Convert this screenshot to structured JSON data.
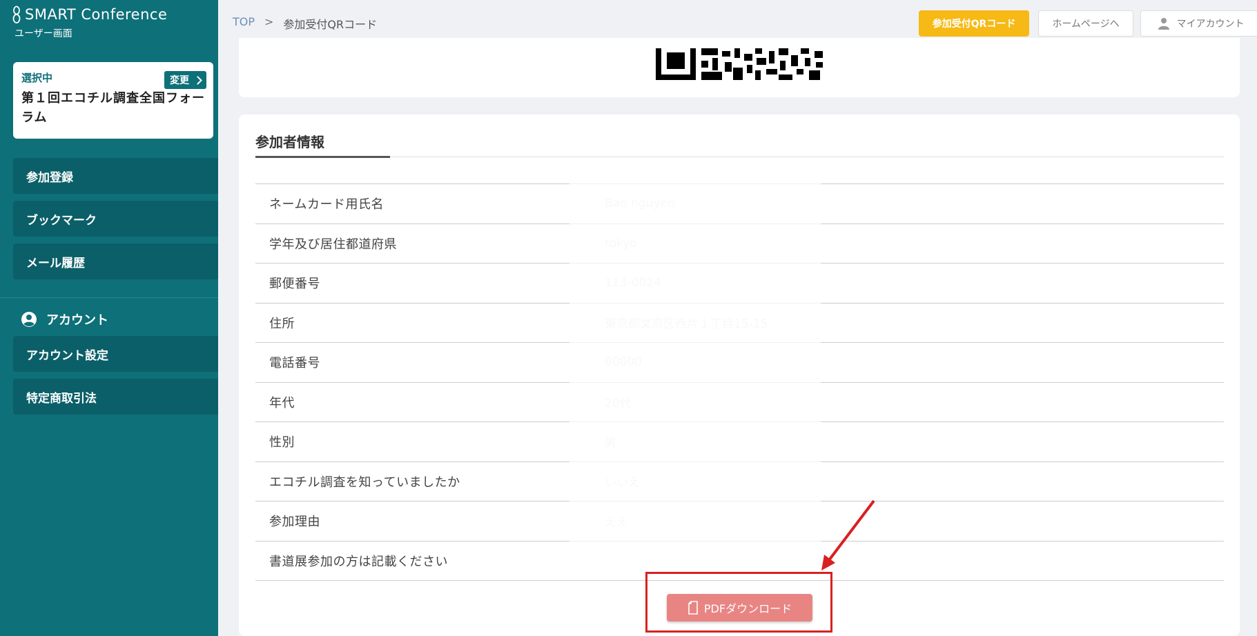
{
  "brand": {
    "title": "SMART Conference",
    "subtitle": "ユーザー画面"
  },
  "selected": {
    "label": "選択中",
    "change": "変更",
    "event_name": "第１回エコチル調査全国フォーラム"
  },
  "nav": {
    "items": [
      "参加登録",
      "ブックマーク",
      "メール履歴"
    ]
  },
  "account": {
    "heading": "アカウント",
    "items": [
      "アカウント設定",
      "特定商取引法"
    ]
  },
  "breadcrumb": {
    "top": "TOP",
    "sep": ">",
    "current": "参加受付QRコード"
  },
  "header": {
    "qr_button": "参加受付QRコード",
    "home_button": "ホームページへ",
    "account_button": "マイアカウント"
  },
  "info": {
    "title": "参加者情報",
    "rows": [
      {
        "label": "ネームカード用氏名",
        "value": "Bao nguyen"
      },
      {
        "label": "学年及び居住都道府県",
        "value": "tokyo"
      },
      {
        "label": "郵便番号",
        "value": "113-0024"
      },
      {
        "label": "住所",
        "value": "東京都文京区西片１丁目15-15"
      },
      {
        "label": "電話番号",
        "value": "00000"
      },
      {
        "label": "年代",
        "value": "20代"
      },
      {
        "label": "性別",
        "value": "男"
      },
      {
        "label": "エコチル調査を知っていましたか",
        "value": "いいえ"
      },
      {
        "label": "参加理由",
        "value": "ええ"
      },
      {
        "label": "書道展参加の方は記載ください",
        "value": ""
      }
    ]
  },
  "pdf_button": "PDFダウンロード",
  "colors": {
    "sidebar": "#0e7079",
    "accent": "#f6b915",
    "pdf": "#e88583",
    "annotation": "#d92020"
  }
}
